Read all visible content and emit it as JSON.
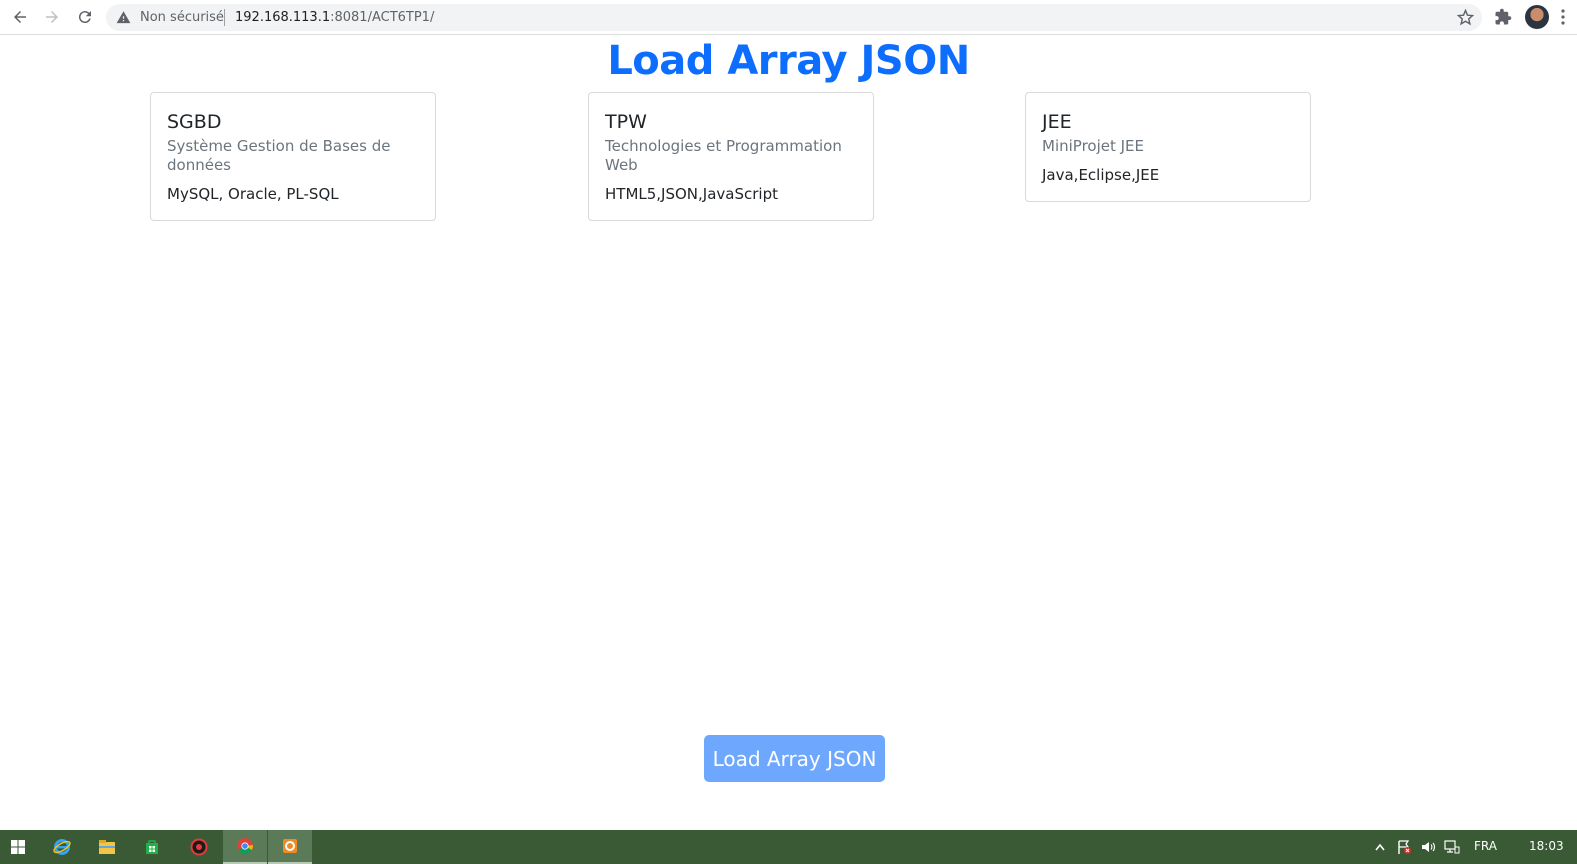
{
  "browser": {
    "security_label": "Non sécurisé",
    "url_host": "192.168.113.1",
    "url_path": ":8081/ACT6TP1/"
  },
  "page": {
    "title": "Load Array JSON",
    "accent_color": "#0d6efd",
    "cards": [
      {
        "title": "SGBD",
        "subtitle": "Système Gestion de Bases de données",
        "text": "MySQL, Oracle, PL-SQL"
      },
      {
        "title": "TPW",
        "subtitle": "Technologies et Programmation Web",
        "text": "HTML5,JSON,JavaScript"
      },
      {
        "title": "JEE",
        "subtitle": "MiniProjet JEE",
        "text": "Java,Eclipse,JEE"
      }
    ],
    "load_button_label": "Load Array JSON"
  },
  "taskbar": {
    "apps": [
      "start-icon",
      "internet-explorer-icon",
      "file-explorer-icon",
      "store-icon",
      "red-app-icon",
      "chrome-icon",
      "orange-app-icon"
    ],
    "language": "FRA",
    "time": "18:03"
  }
}
